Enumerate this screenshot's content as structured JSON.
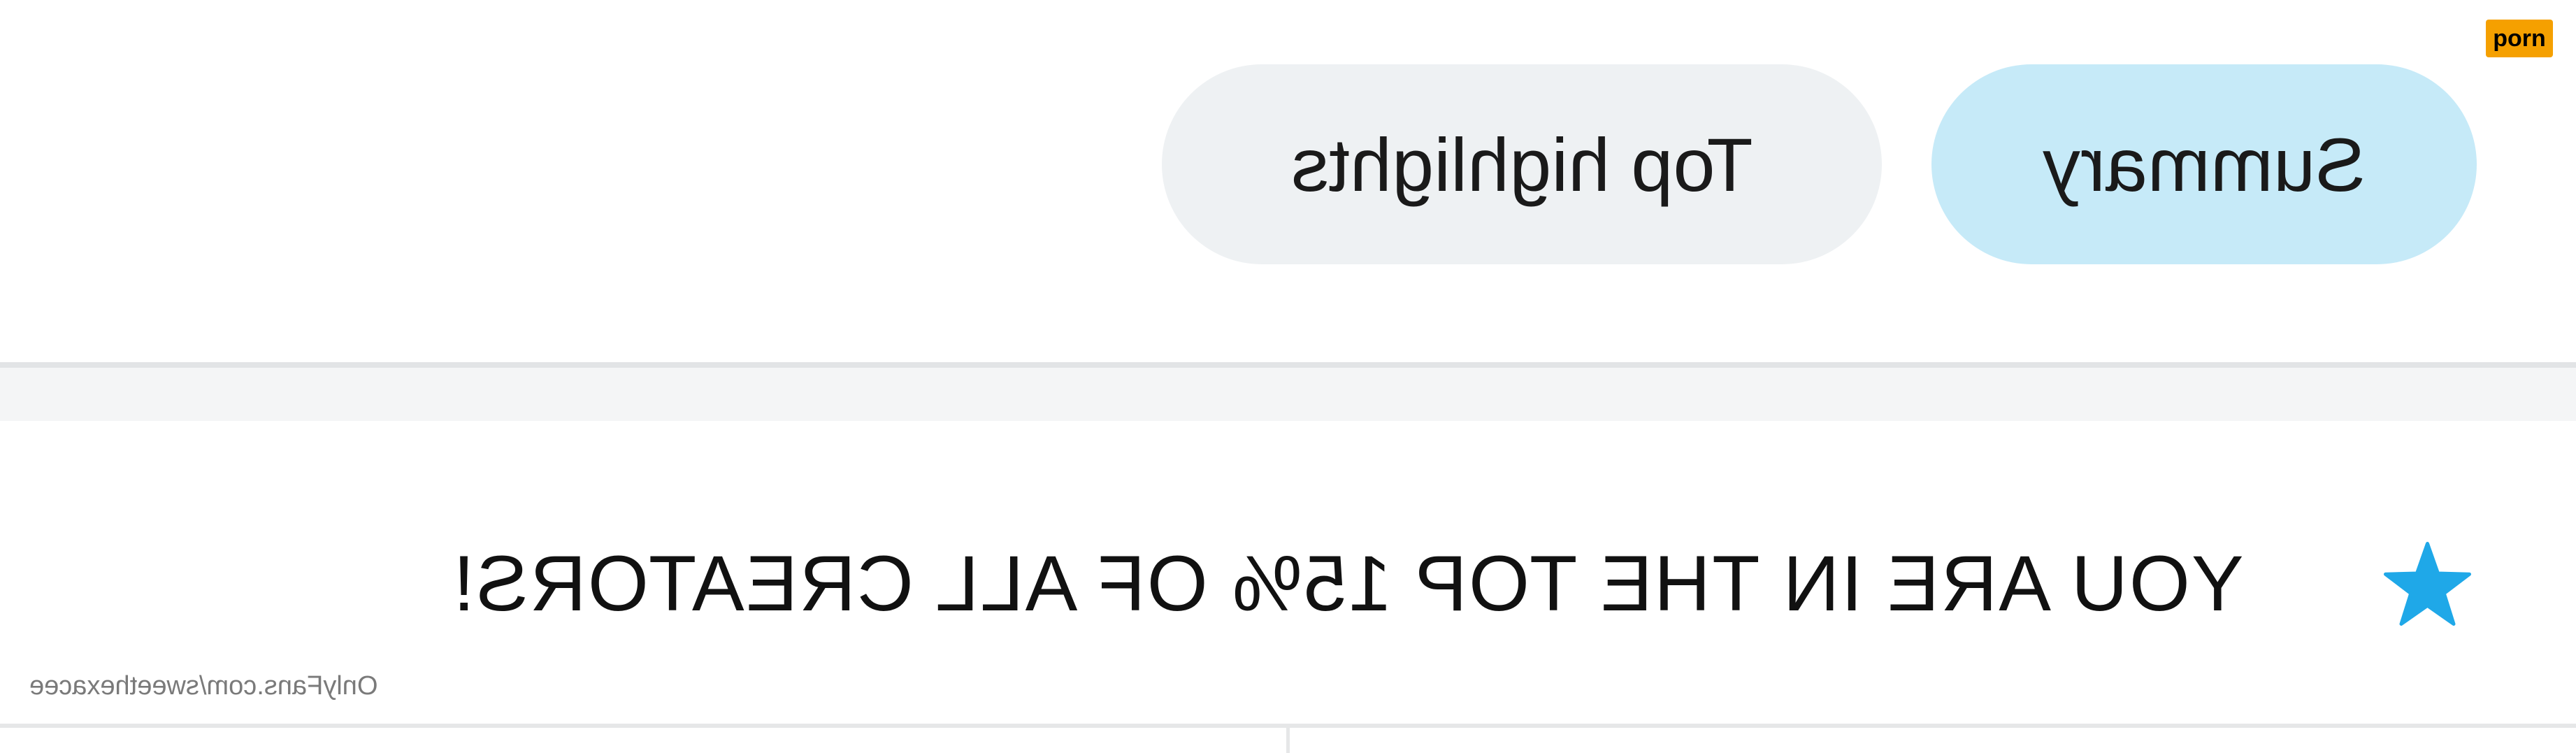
{
  "badge": {
    "label": "porn"
  },
  "tabs": [
    {
      "label": "Top highlights",
      "selected": false
    },
    {
      "label": "Summary",
      "selected": true
    }
  ],
  "banner": {
    "text": "YOU ARE IN THE TOP 15% OF ALL CREATORS!",
    "icon": "star-icon"
  },
  "source": {
    "text": "OnlyFans.com/sweethexacee"
  },
  "colors": {
    "selected_tab": "#c6eaf8",
    "unselected_tab": "#eef1f3",
    "star": "#1fa8e8",
    "badge": "#f5a000"
  }
}
